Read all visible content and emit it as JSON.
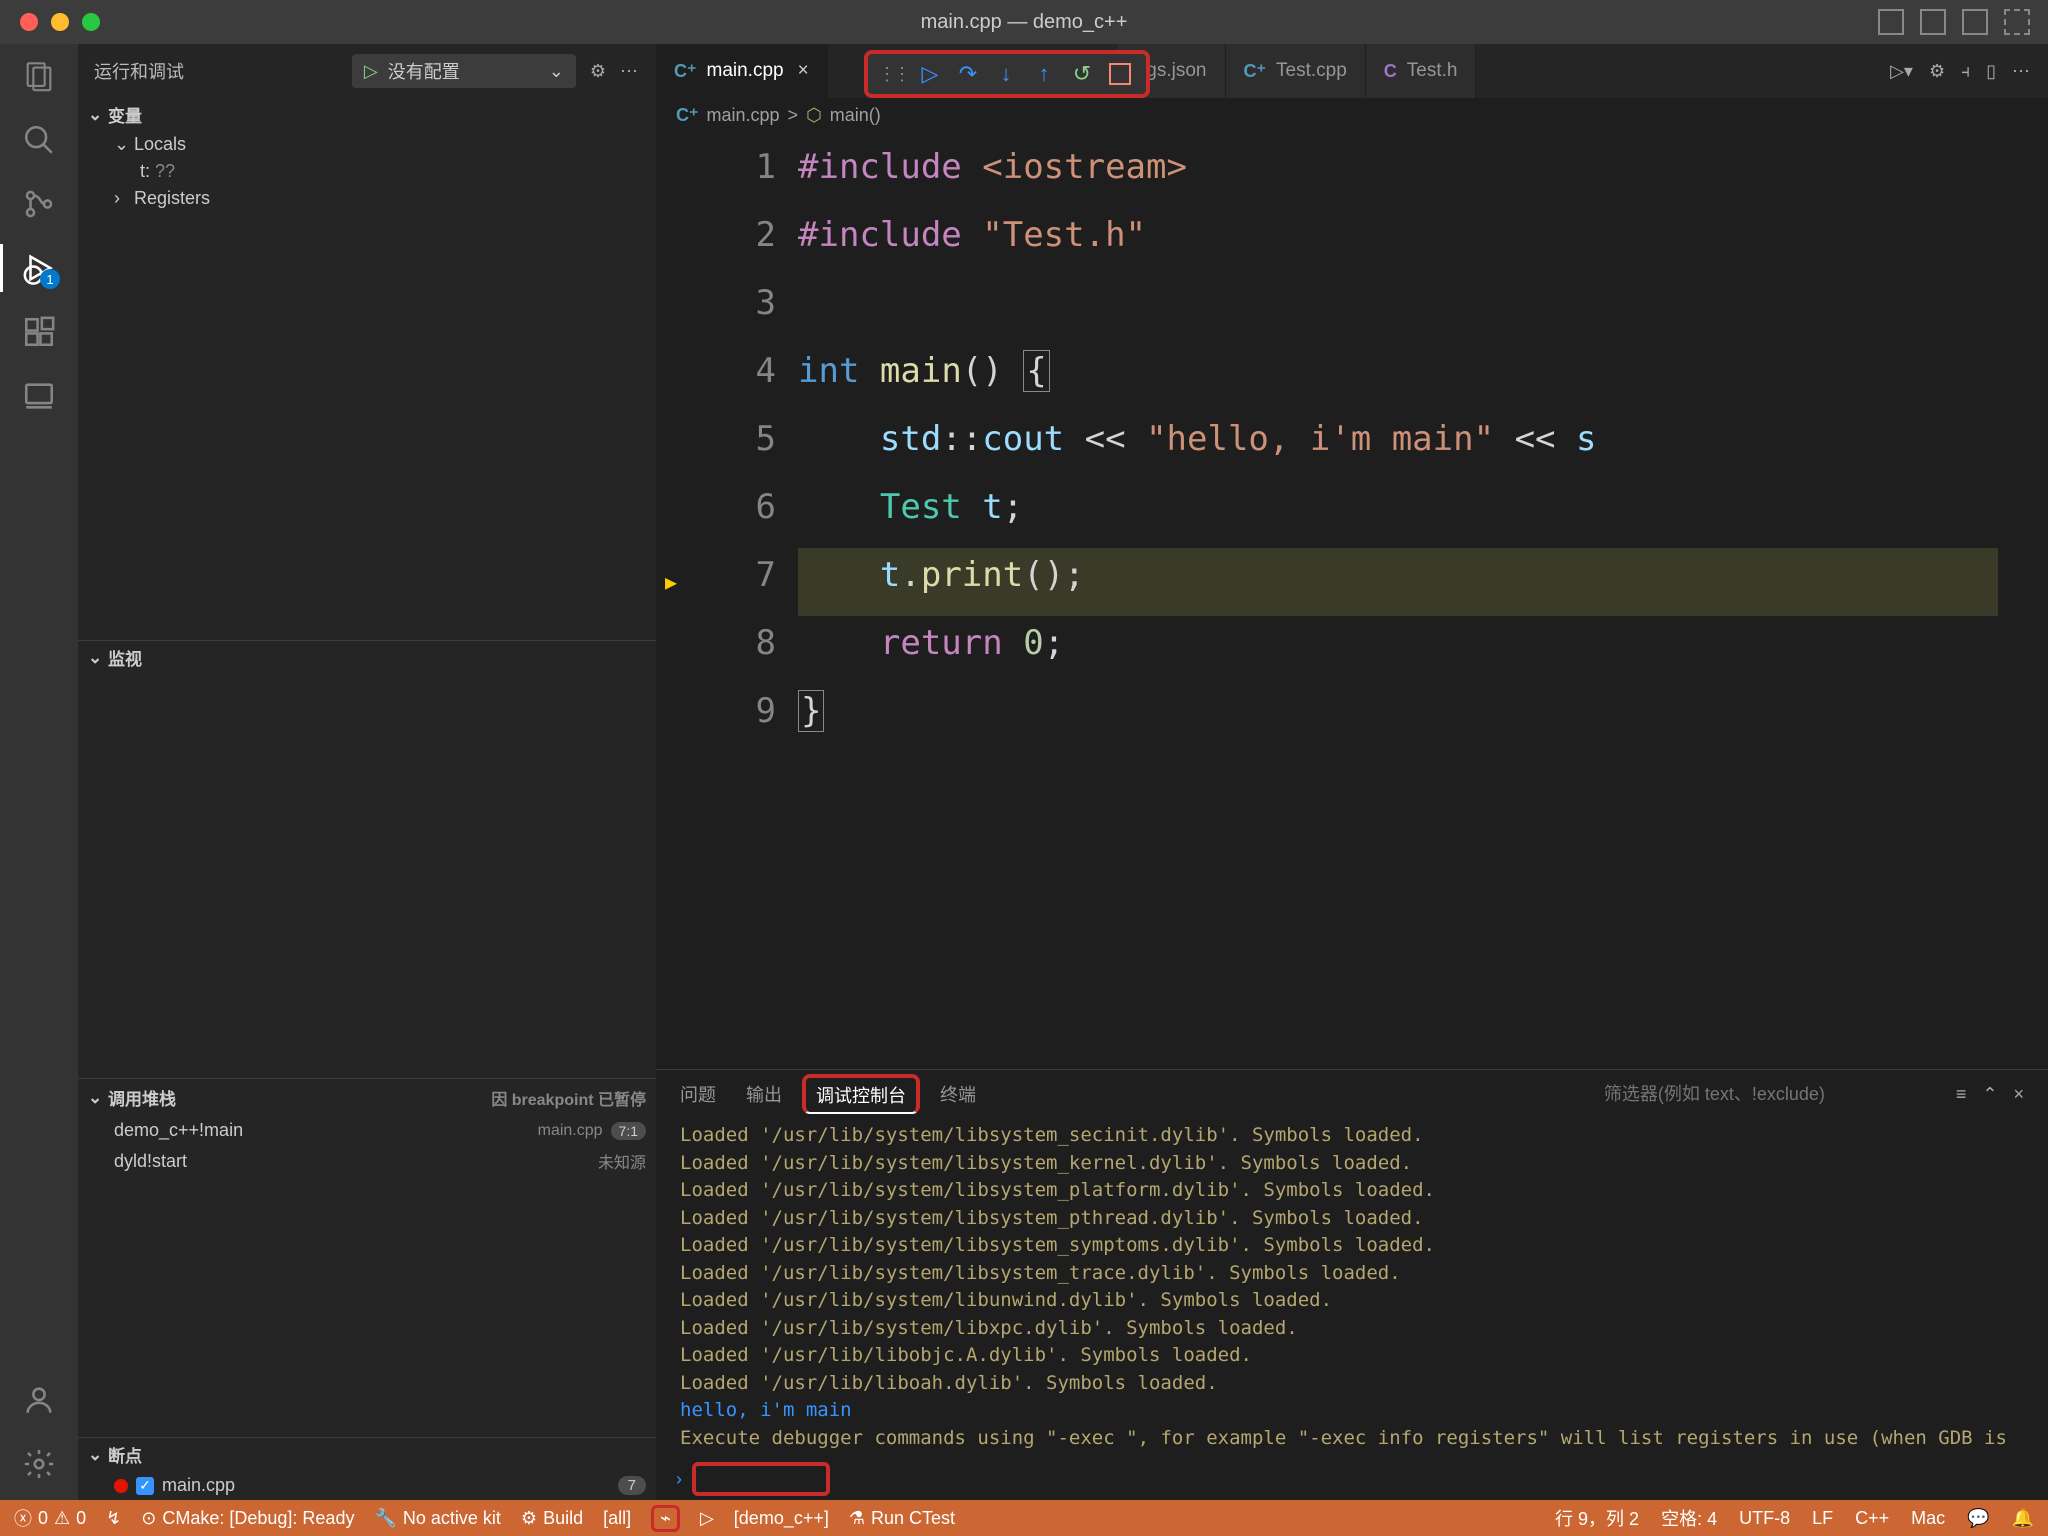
{
  "window": {
    "title": "main.cpp — demo_c++"
  },
  "sidebar": {
    "run_title": "运行和调试",
    "config_label": "没有配置",
    "sections": {
      "variables": "变量",
      "locals": "Locals",
      "registers": "Registers",
      "watch": "监视",
      "callstack": "调用堆栈",
      "breakpoints": "断点"
    },
    "var_t_name": "t:",
    "var_t_val": "??",
    "callstack_status": "因 breakpoint 已暂停",
    "stack": [
      {
        "name": "demo_c++!main",
        "file": "main.cpp",
        "pos": "7:1"
      },
      {
        "name": "dyld!start",
        "file": "未知源",
        "pos": ""
      }
    ],
    "bp_file": "main.cpp",
    "bp_line": "7"
  },
  "tabs": {
    "items": [
      {
        "label": "main.cpp",
        "active": true,
        "ico": "C⁺"
      },
      {
        "label": "ngs.json",
        "active": false,
        "ico": ""
      },
      {
        "label": "Test.cpp",
        "active": false,
        "ico": "C⁺"
      },
      {
        "label": "Test.h",
        "active": false,
        "ico": "C"
      }
    ]
  },
  "breadcrumb": {
    "file": "main.cpp",
    "sep": ">",
    "fn": "main()"
  },
  "code": {
    "lines": [
      {
        "n": "1",
        "hl": false,
        "html": "<span class='k'>#include</span> <span class='s'>&lt;iostream&gt;</span>"
      },
      {
        "n": "2",
        "hl": false,
        "html": "<span class='k'>#include</span> <span class='s'>\"Test.h\"</span>"
      },
      {
        "n": "3",
        "hl": false,
        "html": ""
      },
      {
        "n": "4",
        "hl": false,
        "html": "<span class='t'>int</span> <span class='f'>main</span><span class='c'>()</span> <span class='c brace'>{</span>"
      },
      {
        "n": "5",
        "hl": false,
        "html": "    <span class='v'>std</span><span class='c'>::</span><span class='v'>cout</span> <span class='c'>&lt;&lt;</span> <span class='s'>\"hello, i'm main\"</span> <span class='c'>&lt;&lt;</span> <span class='v'>s</span>"
      },
      {
        "n": "6",
        "hl": false,
        "html": "    <span class='cls'>Test</span> <span class='v'>t</span><span class='c'>;</span>"
      },
      {
        "n": "7",
        "hl": true,
        "exec": true,
        "html": "    <span class='v'>t</span><span class='c'>.</span><span class='f'>print</span><span class='c'>();</span>"
      },
      {
        "n": "8",
        "hl": false,
        "html": "    <span class='k'>return</span> <span class='n'>0</span><span class='c'>;</span>"
      },
      {
        "n": "9",
        "hl": false,
        "html": "<span class='c brace'>}</span>"
      }
    ]
  },
  "panel": {
    "tabs": {
      "problems": "问题",
      "output": "输出",
      "debug_console": "调试控制台",
      "terminal": "终端"
    },
    "filter_placeholder": "筛选器(例如 text、!exclude)",
    "lines": [
      "Loaded '/usr/lib/system/libsystem_secinit.dylib'. Symbols loaded.",
      "Loaded '/usr/lib/system/libsystem_kernel.dylib'. Symbols loaded.",
      "Loaded '/usr/lib/system/libsystem_platform.dylib'. Symbols loaded.",
      "Loaded '/usr/lib/system/libsystem_pthread.dylib'. Symbols loaded.",
      "Loaded '/usr/lib/system/libsystem_symptoms.dylib'. Symbols loaded.",
      "Loaded '/usr/lib/system/libsystem_trace.dylib'. Symbols loaded.",
      "Loaded '/usr/lib/system/libunwind.dylib'. Symbols loaded.",
      "Loaded '/usr/lib/system/libxpc.dylib'. Symbols loaded.",
      "Loaded '/usr/lib/libobjc.A.dylib'. Symbols loaded.",
      "Loaded '/usr/lib/liboah.dylib'. Symbols loaded."
    ],
    "output_line": "hello, i'm main",
    "hint": "Execute debugger commands using \"-exec <command>\", for example \"-exec info registers\" will list registers in use (when GDB is the debugger)"
  },
  "status": {
    "errors": "0",
    "warnings": "0",
    "cmake": "CMake: [Debug]: Ready",
    "kit": "No active kit",
    "build": "Build",
    "target": "[all]",
    "launch": "[demo_c++]",
    "ctest": "Run CTest",
    "cursor": "行 9，列 2",
    "spaces": "空格: 4",
    "encoding": "UTF-8",
    "eol": "LF",
    "lang": "C++",
    "os": "Mac"
  }
}
